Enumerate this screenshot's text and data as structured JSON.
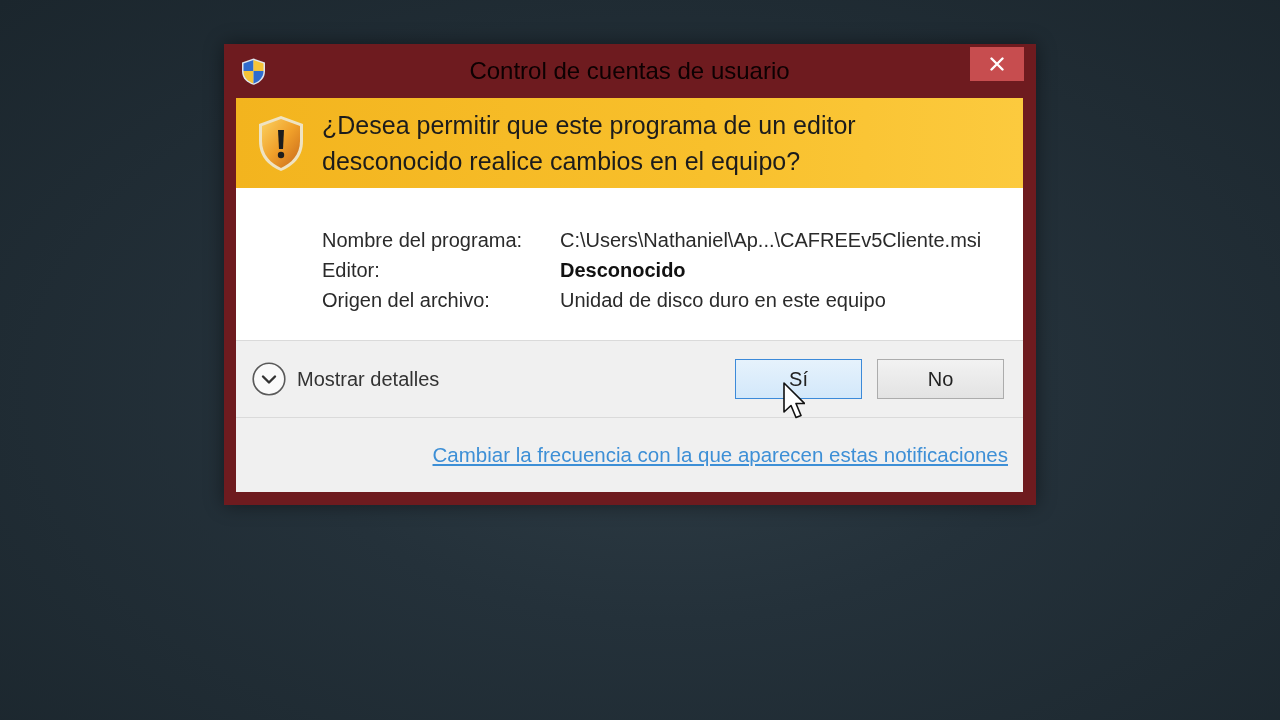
{
  "window": {
    "title": "Control de cuentas de usuario"
  },
  "header": {
    "question": "¿Desea permitir que este programa de un editor desconocido realice cambios en el equipo?"
  },
  "details": [
    {
      "label": "Nombre del programa:",
      "value": "C:\\Users\\Nathaniel\\Ap...\\CAFREEv5Cliente.msi",
      "emphasized": false
    },
    {
      "label": "Editor:",
      "value": "Desconocido",
      "emphasized": true
    },
    {
      "label": "Origen del archivo:",
      "value": "Unidad de disco duro en este equipo",
      "emphasized": false
    }
  ],
  "details_toggle": {
    "label": "Mostrar detalles",
    "expanded": false
  },
  "buttons": [
    {
      "label": "Sí",
      "hovered": true
    },
    {
      "label": "No",
      "hovered": false
    }
  ],
  "link": "Cambiar la frecuencia con la que aparecen estas notificaciones"
}
